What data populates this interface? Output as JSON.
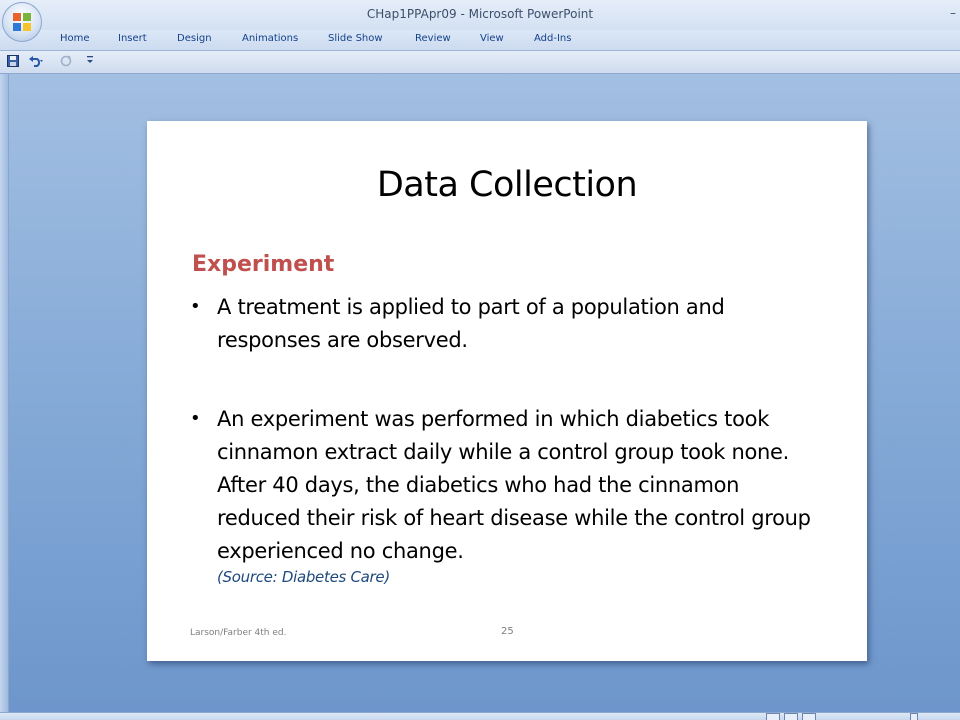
{
  "window": {
    "title": "CHap1PPApr09 - Microsoft PowerPoint",
    "right_glyph": "–"
  },
  "ribbon": {
    "tabs": [
      "Home",
      "Insert",
      "Design",
      "Animations",
      "Slide Show",
      "Review",
      "View",
      "Add-Ins"
    ]
  },
  "qat": {
    "items": [
      "save-icon",
      "undo-icon",
      "redo-icon",
      "customize-icon"
    ]
  },
  "slide": {
    "title": "Data Collection",
    "subtitle": "Experiment",
    "bullets": [
      "A treatment is applied to part of a population and responses are observed.",
      "An experiment was performed in which diabetics took cinnamon extract daily while a control group took none. After 40 days, the diabetics who had the cinnamon reduced their risk of heart disease while the control group experienced no change."
    ],
    "source": "(Source: Diabetes Care)",
    "footer_left": "Larson/Farber 4th ed.",
    "page_number": "25"
  },
  "colors": {
    "subtitle": "#c0504d",
    "source": "#1f497d",
    "ribbon_text": "#15428b"
  }
}
